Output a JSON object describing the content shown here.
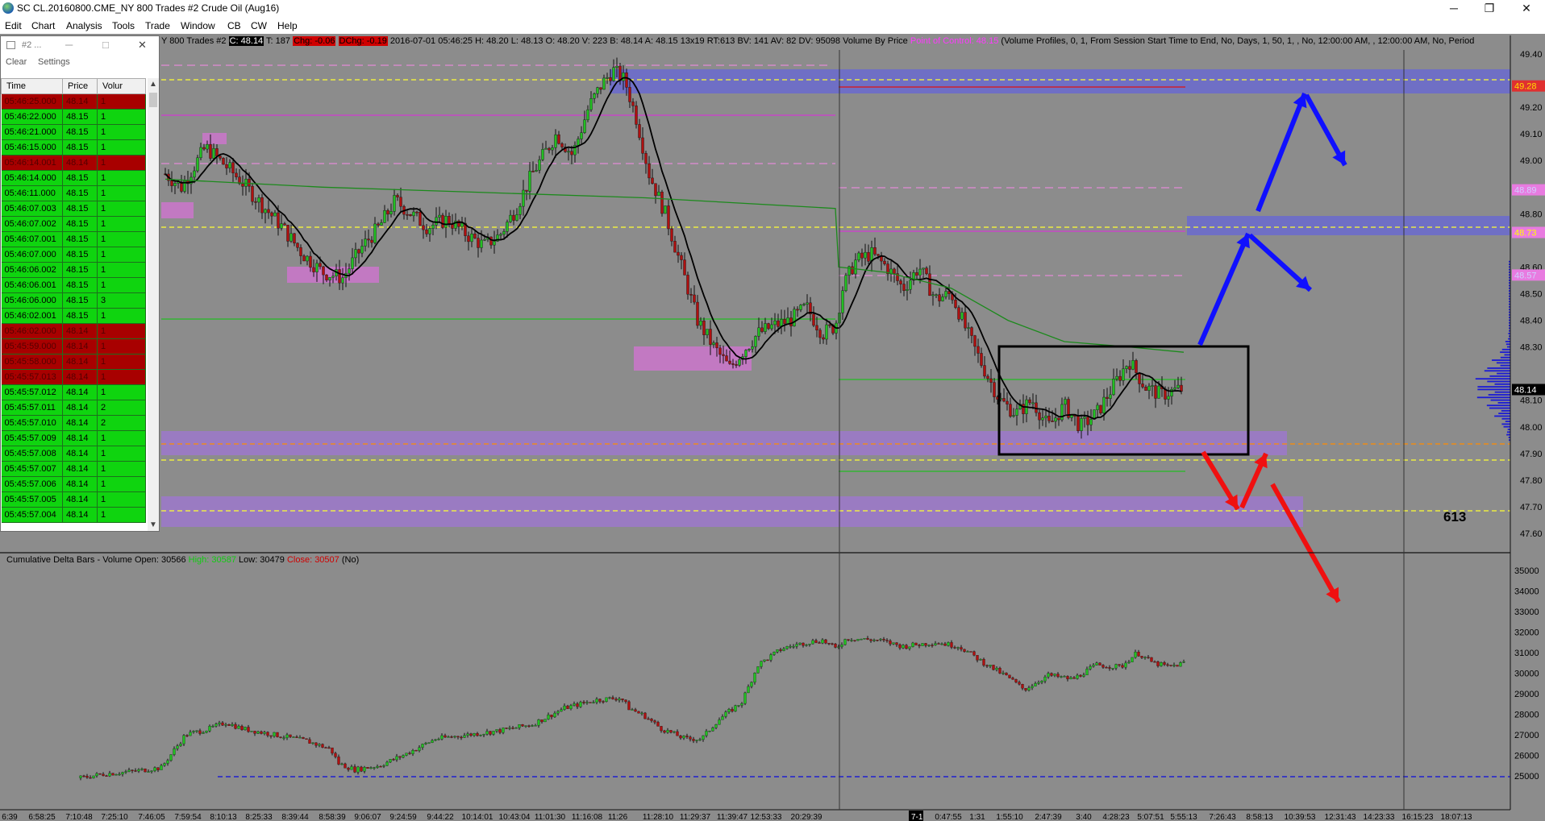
{
  "window": {
    "title": "SC CL.20160800.CME_NY  800 Trades  #2  Crude Oil (Aug16)",
    "minimize": "─",
    "restore": "❐",
    "close": "✕"
  },
  "menu": [
    "Edit",
    "Chart",
    "Analysis",
    "Tools",
    "Trade",
    "Window",
    "CB",
    "CW",
    "Help"
  ],
  "chart_header": {
    "symbol_frag": "Y  800 Trades  #2",
    "close_badge": "C: 48.14",
    "ticks": "T: 187",
    "chg": "Chg: -0.06",
    "dchg": "DChg: -0.19",
    "stats": "2016-07-01 05:46:25 H: 48.20 L: 48.13 O: 48.20 V: 223 B: 48.14 A: 48.15 13x19 RT:613 BV: 141 AV: 82 DV: 95098 Volume By Price",
    "poc": "Point of Control: 48.15",
    "tail": "(Volume Profiles, 0, 1, From Session Start Time to End, No, Days, 1, 50, 1, , No, 12:00:00 AM, , 12:00:00 AM, No, Period"
  },
  "time_sales": {
    "title": "#2 ...",
    "toolbar": [
      "Clear",
      "Settings"
    ],
    "columns": [
      "Time",
      "Price",
      "Volur"
    ],
    "rows": [
      {
        "time": "05:46:25.000",
        "price": "48.14",
        "vol": "1",
        "side": "r"
      },
      {
        "time": "05:46:22.000",
        "price": "48.15",
        "vol": "1",
        "side": "g"
      },
      {
        "time": "05:46:21.000",
        "price": "48.15",
        "vol": "1",
        "side": "g"
      },
      {
        "time": "05:46:15.000",
        "price": "48.15",
        "vol": "1",
        "side": "g"
      },
      {
        "time": "05:46:14.001",
        "price": "48.14",
        "vol": "1",
        "side": "r"
      },
      {
        "time": "05:46:14.000",
        "price": "48.15",
        "vol": "1",
        "side": "g"
      },
      {
        "time": "05:46:11.000",
        "price": "48.15",
        "vol": "1",
        "side": "g"
      },
      {
        "time": "05:46:07.003",
        "price": "48.15",
        "vol": "1",
        "side": "g"
      },
      {
        "time": "05:46:07.002",
        "price": "48.15",
        "vol": "1",
        "side": "g"
      },
      {
        "time": "05:46:07.001",
        "price": "48.15",
        "vol": "1",
        "side": "g"
      },
      {
        "time": "05:46:07.000",
        "price": "48.15",
        "vol": "1",
        "side": "g"
      },
      {
        "time": "05:46:06.002",
        "price": "48.15",
        "vol": "1",
        "side": "g"
      },
      {
        "time": "05:46:06.001",
        "price": "48.15",
        "vol": "1",
        "side": "g"
      },
      {
        "time": "05:46:06.000",
        "price": "48.15",
        "vol": "3",
        "side": "g"
      },
      {
        "time": "05:46:02.001",
        "price": "48.15",
        "vol": "1",
        "side": "g"
      },
      {
        "time": "05:46:02.000",
        "price": "48.14",
        "vol": "1",
        "side": "r"
      },
      {
        "time": "05:45:59.000",
        "price": "48.14",
        "vol": "1",
        "side": "r"
      },
      {
        "time": "05:45:58.000",
        "price": "48.14",
        "vol": "1",
        "side": "r"
      },
      {
        "time": "05:45:57.013",
        "price": "48.14",
        "vol": "1",
        "side": "r"
      },
      {
        "time": "05:45:57.012",
        "price": "48.14",
        "vol": "1",
        "side": "g"
      },
      {
        "time": "05:45:57.011",
        "price": "48.14",
        "vol": "2",
        "side": "g"
      },
      {
        "time": "05:45:57.010",
        "price": "48.14",
        "vol": "2",
        "side": "g"
      },
      {
        "time": "05:45:57.009",
        "price": "48.14",
        "vol": "1",
        "side": "g"
      },
      {
        "time": "05:45:57.008",
        "price": "48.14",
        "vol": "1",
        "side": "g"
      },
      {
        "time": "05:45:57.007",
        "price": "48.14",
        "vol": "1",
        "side": "g"
      },
      {
        "time": "05:45:57.006",
        "price": "48.14",
        "vol": "1",
        "side": "g"
      },
      {
        "time": "05:45:57.005",
        "price": "48.14",
        "vol": "1",
        "side": "g"
      },
      {
        "time": "05:45:57.004",
        "price": "48.14",
        "vol": "1",
        "side": "g"
      }
    ]
  },
  "price_axis": {
    "labels": [
      "49.40",
      "49.20",
      "49.10",
      "49.00",
      "48.80",
      "48.60",
      "48.50",
      "48.40",
      "48.30",
      "48.10",
      "48.00",
      "47.90",
      "47.80",
      "47.70",
      "47.60"
    ],
    "marker_last": "48.14",
    "marker_red": "49.28",
    "marker_pink_1": "48.89",
    "marker_pink_2": "48.73",
    "marker_pink_3": "48.57"
  },
  "annotation_613": "613",
  "delta_header": {
    "label": "Cumulative Delta Bars - Volume",
    "open": "Open: 30566",
    "high": "High: 30587",
    "low": "Low: 30479",
    "close": "Close: 30507",
    "suffix": "(No)"
  },
  "delta_axis": [
    "35000",
    "34000",
    "33000",
    "32000",
    "31000",
    "30000",
    "29000",
    "28000",
    "27000",
    "26000",
    "25000"
  ],
  "time_axis": [
    "6:39",
    "6:58:25",
    "7:10:48",
    "7:25:10",
    "7:46:05",
    "7:59:54",
    "8:10:13",
    "8:25:33",
    "8:39:44",
    "8:58:39",
    "9:06:07",
    "9:24:59",
    "9:44:22",
    "10:14:01",
    "10:43:04",
    "11:01:30",
    "11:16:08",
    "11:26",
    "11:28:10",
    "11:29:37",
    "11:39:47",
    "12:53:33",
    "20:29:39",
    "7-1",
    "0:47:55",
    "1:31",
    "1:55:10",
    "2:47:39",
    "3:40",
    "4:28:23",
    "5:07:51",
    "5:55:13",
    "7:26:43",
    "8:58:13",
    "10:39:53",
    "12:31:43",
    "14:23:33",
    "16:15:23",
    "18:07:13"
  ],
  "colors": {
    "chart_bg": "#8c8c8c",
    "up_bar": "#22c022",
    "down_bar": "#b01010",
    "zone_blue": "#6b6ccb",
    "zone_violet": "#9b79c8",
    "zone_pink": "#c877c8",
    "arrow_blue": "#1010ff",
    "arrow_red": "#f01010",
    "level_yellow": "#ffff33",
    "level_orange": "#ff8c00"
  }
}
